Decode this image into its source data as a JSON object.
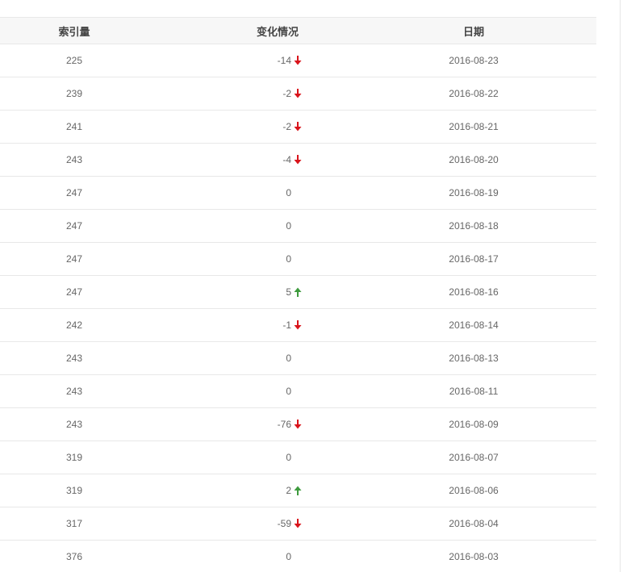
{
  "table": {
    "headers": [
      "索引量",
      "变化情况",
      "日期"
    ],
    "rows": [
      {
        "index": "225",
        "change": "-14",
        "direction": "down",
        "date": "2016-08-23"
      },
      {
        "index": "239",
        "change": "-2",
        "direction": "down",
        "date": "2016-08-22"
      },
      {
        "index": "241",
        "change": "-2",
        "direction": "down",
        "date": "2016-08-21"
      },
      {
        "index": "243",
        "change": "-4",
        "direction": "down",
        "date": "2016-08-20"
      },
      {
        "index": "247",
        "change": "0",
        "direction": "none",
        "date": "2016-08-19"
      },
      {
        "index": "247",
        "change": "0",
        "direction": "none",
        "date": "2016-08-18"
      },
      {
        "index": "247",
        "change": "0",
        "direction": "none",
        "date": "2016-08-17"
      },
      {
        "index": "247",
        "change": "5",
        "direction": "up",
        "date": "2016-08-16"
      },
      {
        "index": "242",
        "change": "-1",
        "direction": "down",
        "date": "2016-08-14"
      },
      {
        "index": "243",
        "change": "0",
        "direction": "none",
        "date": "2016-08-13"
      },
      {
        "index": "243",
        "change": "0",
        "direction": "none",
        "date": "2016-08-11"
      },
      {
        "index": "243",
        "change": "-76",
        "direction": "down",
        "date": "2016-08-09"
      },
      {
        "index": "319",
        "change": "0",
        "direction": "none",
        "date": "2016-08-07"
      },
      {
        "index": "319",
        "change": "2",
        "direction": "up",
        "date": "2016-08-06"
      },
      {
        "index": "317",
        "change": "-59",
        "direction": "down",
        "date": "2016-08-04"
      },
      {
        "index": "376",
        "change": "0",
        "direction": "none",
        "date": "2016-08-03"
      }
    ]
  },
  "colors": {
    "down": "#d9141b",
    "up": "#3e9b3e"
  },
  "icons": {
    "down": "arrow-down-icon",
    "up": "arrow-up-icon"
  }
}
